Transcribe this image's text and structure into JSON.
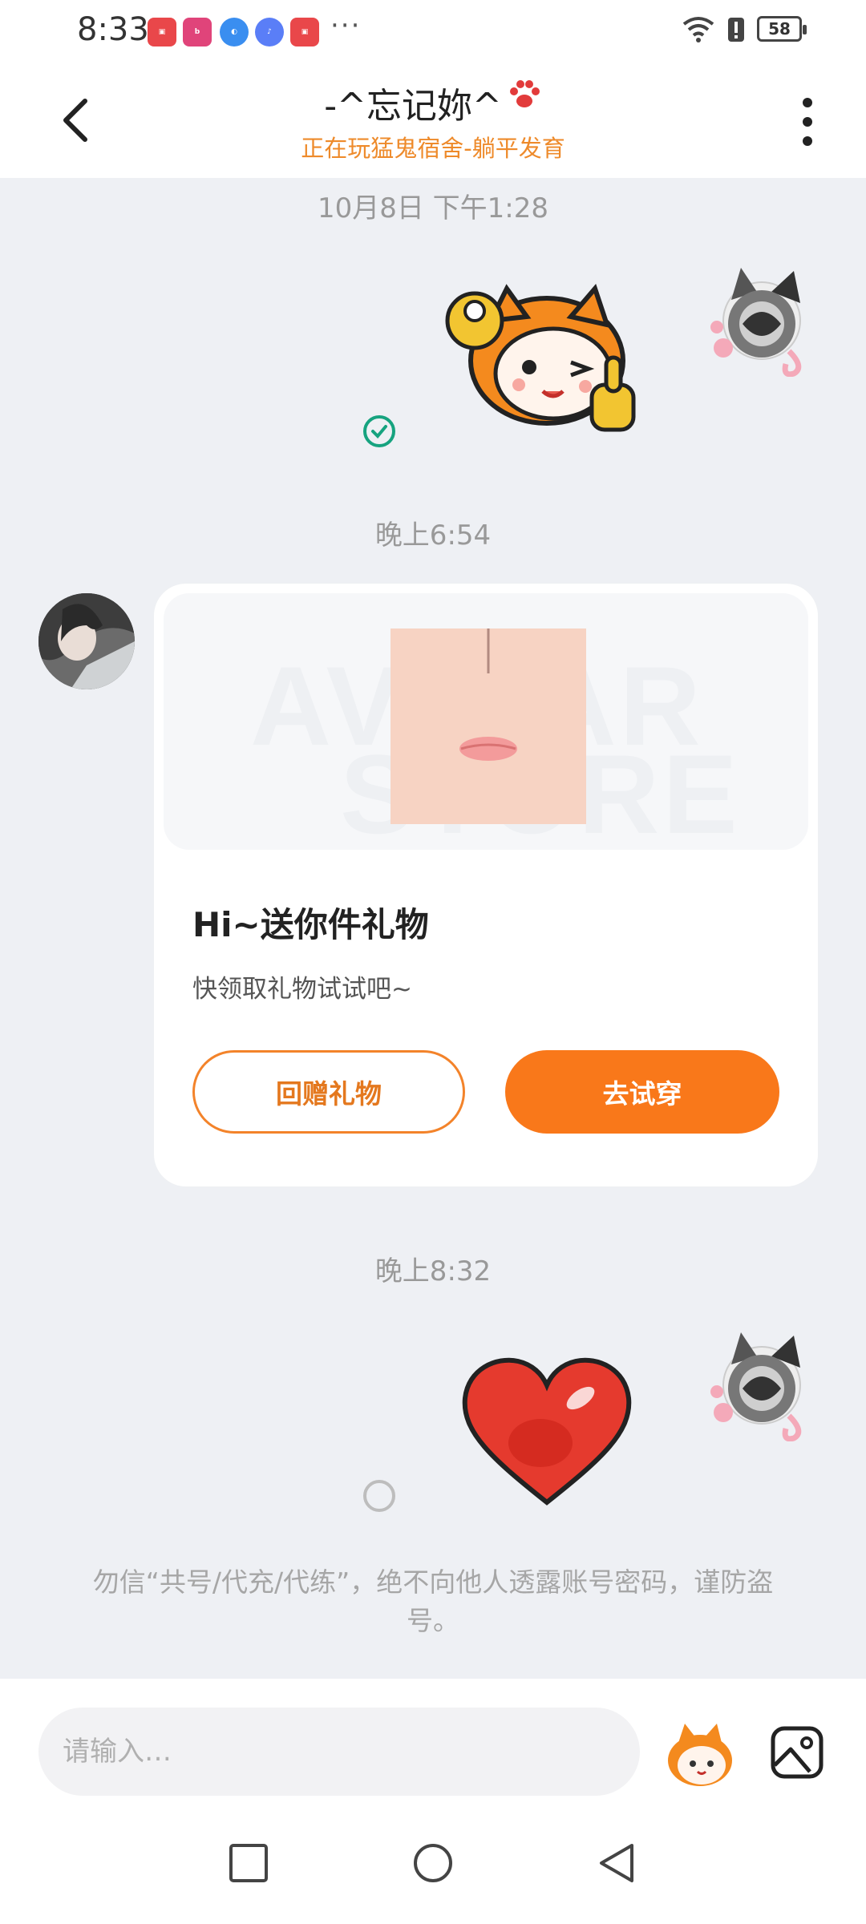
{
  "status_bar": {
    "time": "8:33",
    "battery": "58",
    "overflow": "···"
  },
  "header": {
    "title": "-^忘记妳^",
    "subtitle": "正在玩猛鬼宿舍-躺平发育"
  },
  "messages": {
    "timestamp_1": "10月8日 下午1:28",
    "timestamp_2": "晚上6:54",
    "timestamp_3": "晚上8:32"
  },
  "gift_card": {
    "watermark_top": "AVATAR",
    "watermark_bottom": "STORE",
    "title": "Hi~送你件礼物",
    "description": "快领取礼物试试吧~",
    "return_button": "回赠礼物",
    "try_button": "去试穿"
  },
  "warning": "勿信“共号/代充/代练”，绝不向他人透露账号密码，谨防盗号。",
  "input": {
    "placeholder": "请输入…"
  },
  "colors": {
    "accent": "#f9781a",
    "subtitle": "#ee8a2a",
    "sent_ok": "#16a37f"
  }
}
